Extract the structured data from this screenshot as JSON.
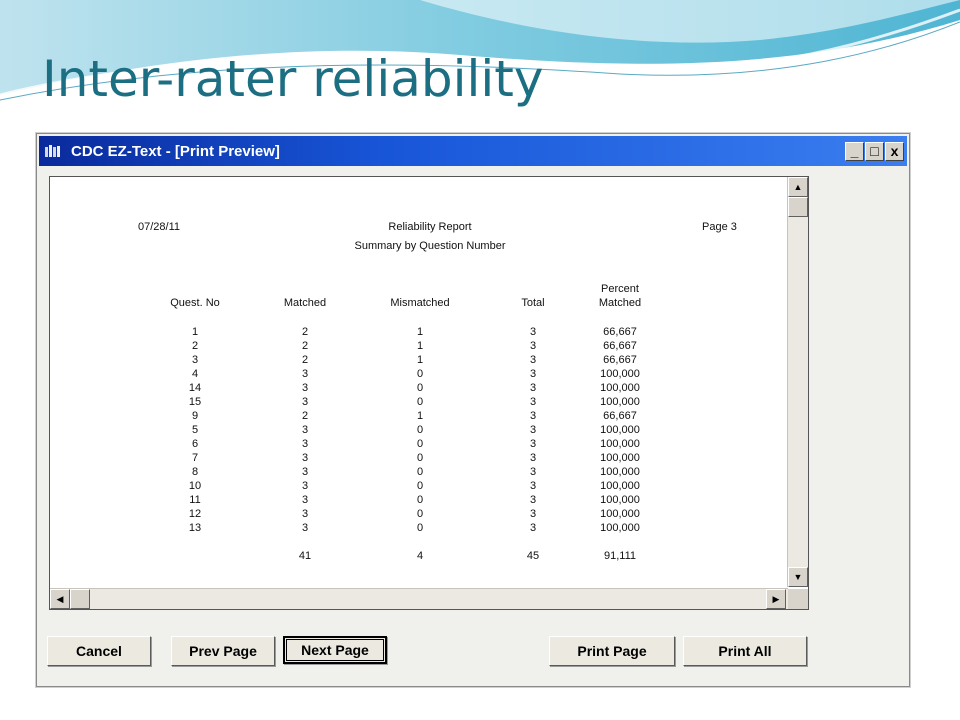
{
  "slide": {
    "title": "Inter-rater reliability"
  },
  "window": {
    "title": "CDC EZ-Text - [Print Preview]",
    "controls": {
      "minimize": "_",
      "maximize": "□",
      "close": "x"
    }
  },
  "report": {
    "date": "07/28/11",
    "title": "Reliability Report",
    "subtitle": "Summary by Question Number",
    "page": "Page 3",
    "columns": {
      "quest_no": "Quest. No",
      "matched": "Matched",
      "mismatched": "Mismatched",
      "total": "Total",
      "percent_top": "Percent",
      "percent_bottom": "Matched"
    },
    "rows": [
      {
        "q": "1",
        "m": "2",
        "mm": "1",
        "t": "3",
        "p": "66,667"
      },
      {
        "q": "2",
        "m": "2",
        "mm": "1",
        "t": "3",
        "p": "66,667"
      },
      {
        "q": "3",
        "m": "2",
        "mm": "1",
        "t": "3",
        "p": "66,667"
      },
      {
        "q": "4",
        "m": "3",
        "mm": "0",
        "t": "3",
        "p": "100,000"
      },
      {
        "q": "14",
        "m": "3",
        "mm": "0",
        "t": "3",
        "p": "100,000"
      },
      {
        "q": "15",
        "m": "3",
        "mm": "0",
        "t": "3",
        "p": "100,000"
      },
      {
        "q": "9",
        "m": "2",
        "mm": "1",
        "t": "3",
        "p": "66,667"
      },
      {
        "q": "5",
        "m": "3",
        "mm": "0",
        "t": "3",
        "p": "100,000"
      },
      {
        "q": "6",
        "m": "3",
        "mm": "0",
        "t": "3",
        "p": "100,000"
      },
      {
        "q": "7",
        "m": "3",
        "mm": "0",
        "t": "3",
        "p": "100,000"
      },
      {
        "q": "8",
        "m": "3",
        "mm": "0",
        "t": "3",
        "p": "100,000"
      },
      {
        "q": "10",
        "m": "3",
        "mm": "0",
        "t": "3",
        "p": "100,000"
      },
      {
        "q": "11",
        "m": "3",
        "mm": "0",
        "t": "3",
        "p": "100,000"
      },
      {
        "q": "12",
        "m": "3",
        "mm": "0",
        "t": "3",
        "p": "100,000"
      },
      {
        "q": "13",
        "m": "3",
        "mm": "0",
        "t": "3",
        "p": "100,000"
      }
    ],
    "totals": {
      "m": "41",
      "mm": "4",
      "t": "45",
      "p": "91,111"
    }
  },
  "buttons": {
    "cancel": "Cancel",
    "prev_page": "Prev Page",
    "next_page": "Next Page",
    "print_page": "Print Page",
    "print_all": "Print All"
  },
  "colors": {
    "title": "#1c6e82",
    "titlebar": "#1856d8"
  }
}
